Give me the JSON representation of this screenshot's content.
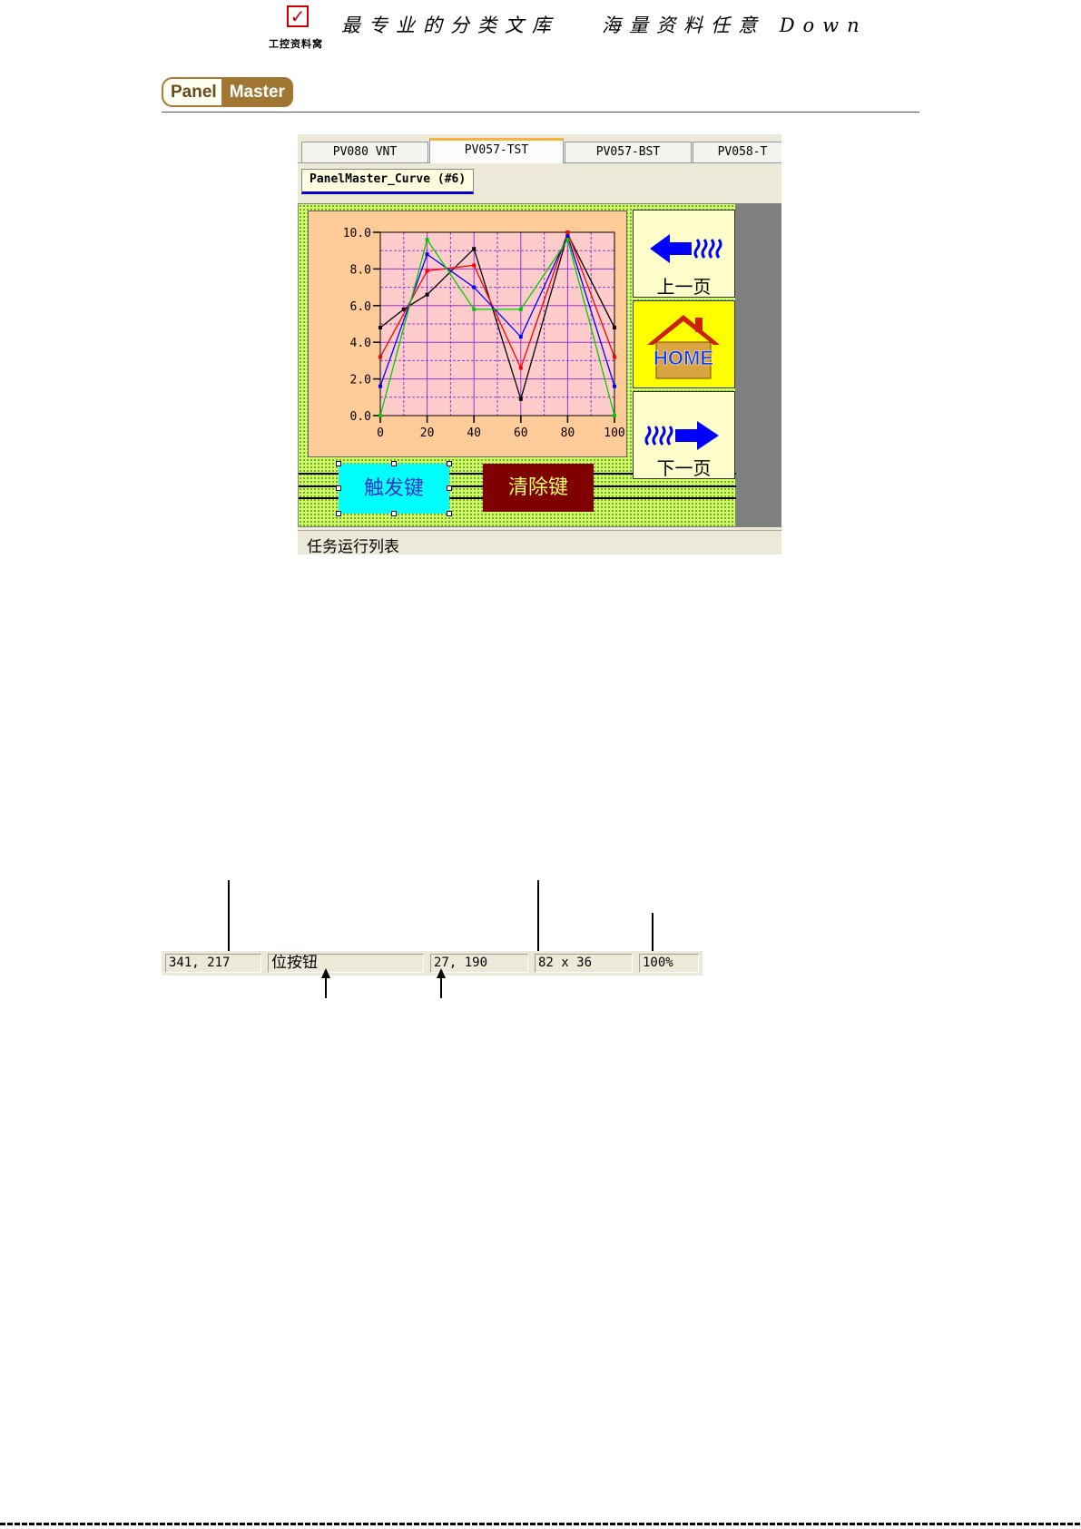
{
  "header": {
    "check_glyph": "✓",
    "site_name": "工控资料窝",
    "tagline": "最专业的分类文库   海量资料任意 Down"
  },
  "logo": {
    "part1": "Panel",
    "part2": "Master"
  },
  "window": {
    "tabs": [
      {
        "label": "PV080 VNT",
        "active": false
      },
      {
        "label": "PV057-TST",
        "active": true
      },
      {
        "label": "PV057-BST",
        "active": false
      },
      {
        "label": "PV058-T",
        "active": false
      }
    ],
    "subtab_label": "PanelMaster_Curve (#6)",
    "nav": {
      "prev_label": "上一页",
      "home_label": "HOME",
      "next_label": "下一页"
    },
    "buttons": {
      "trigger": "触发键",
      "clear": "清除键"
    },
    "taskbar_label": "任务运行列表"
  },
  "chart_data": {
    "type": "line",
    "x": [
      0,
      20,
      40,
      60,
      80,
      100
    ],
    "xticks": [
      "0",
      "20",
      "40",
      "60",
      "80",
      "100"
    ],
    "yticks": [
      "0.0",
      "2.0",
      "4.0",
      "6.0",
      "8.0",
      "10.0"
    ],
    "xlim": [
      0,
      100
    ],
    "ylim": [
      0,
      10
    ],
    "grid": true,
    "background": "#ffcccc",
    "series": [
      {
        "color": "#000000",
        "points": [
          [
            0,
            4.8
          ],
          [
            10,
            5.8
          ],
          [
            20,
            6.6
          ],
          [
            40,
            9.1
          ],
          [
            60,
            0.9
          ],
          [
            80,
            9.9
          ],
          [
            100,
            4.8
          ]
        ]
      },
      {
        "color": "#ff0000",
        "points": [
          [
            0,
            3.2
          ],
          [
            20,
            7.9
          ],
          [
            40,
            8.2
          ],
          [
            60,
            2.6
          ],
          [
            80,
            10.0
          ],
          [
            100,
            3.2
          ]
        ]
      },
      {
        "color": "#0000ff",
        "points": [
          [
            0,
            1.6
          ],
          [
            20,
            8.8
          ],
          [
            40,
            7.0
          ],
          [
            60,
            4.3
          ],
          [
            80,
            9.8
          ],
          [
            100,
            1.6
          ]
        ]
      },
      {
        "color": "#00cc00",
        "points": [
          [
            0,
            0.0
          ],
          [
            20,
            9.6
          ],
          [
            40,
            5.8
          ],
          [
            60,
            5.8
          ],
          [
            80,
            9.6
          ],
          [
            100,
            0.0
          ]
        ]
      }
    ]
  },
  "statusbar": {
    "cursor_pos": "341, 217",
    "object_name": "位按钮",
    "object_pos": "27, 190",
    "object_size": "82 x 36",
    "zoom": "100%"
  }
}
